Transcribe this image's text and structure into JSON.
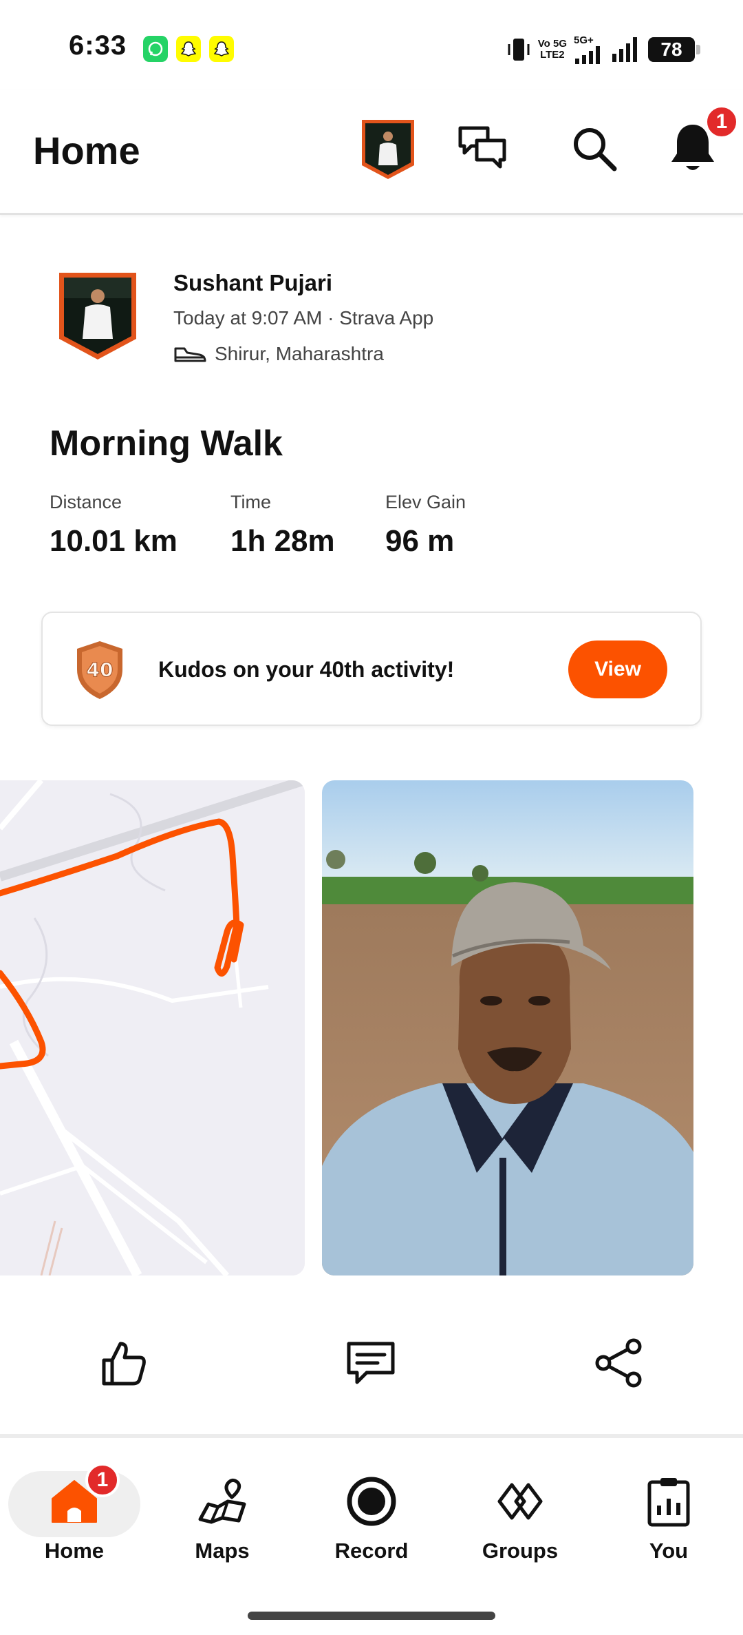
{
  "status_bar": {
    "time": "6:33",
    "network_label_1": "Vo 5G",
    "network_label_2": "LTE2",
    "network_type": "5G+",
    "battery": "78",
    "notification_apps": [
      "whatsapp-icon",
      "snapchat-icon",
      "snapchat-icon"
    ]
  },
  "header": {
    "title": "Home",
    "notifications_count": "1"
  },
  "activity": {
    "athlete_name": "Sushant Pujari",
    "meta": "Today at 9:07 AM · Strava App",
    "location": "Shirur, Maharashtra",
    "title": "Morning Walk",
    "stats": [
      {
        "label": "Distance",
        "value": "10.01 km"
      },
      {
        "label": "Time",
        "value": "1h 28m"
      },
      {
        "label": "Elev Gain",
        "value": "96 m"
      }
    ]
  },
  "kudos": {
    "badge_number": "40",
    "message": "Kudos on your 40th activity!",
    "button_label": "View"
  },
  "actions": [
    "like-button",
    "comment-button",
    "share-button"
  ],
  "bottom_nav": {
    "items": [
      {
        "label": "Home",
        "badge": "1",
        "active": true
      },
      {
        "label": "Maps"
      },
      {
        "label": "Record"
      },
      {
        "label": "Groups"
      },
      {
        "label": "You"
      }
    ]
  },
  "colors": {
    "brand": "#fc5200",
    "badge": "#e22a2a",
    "route": "#fc5200"
  }
}
